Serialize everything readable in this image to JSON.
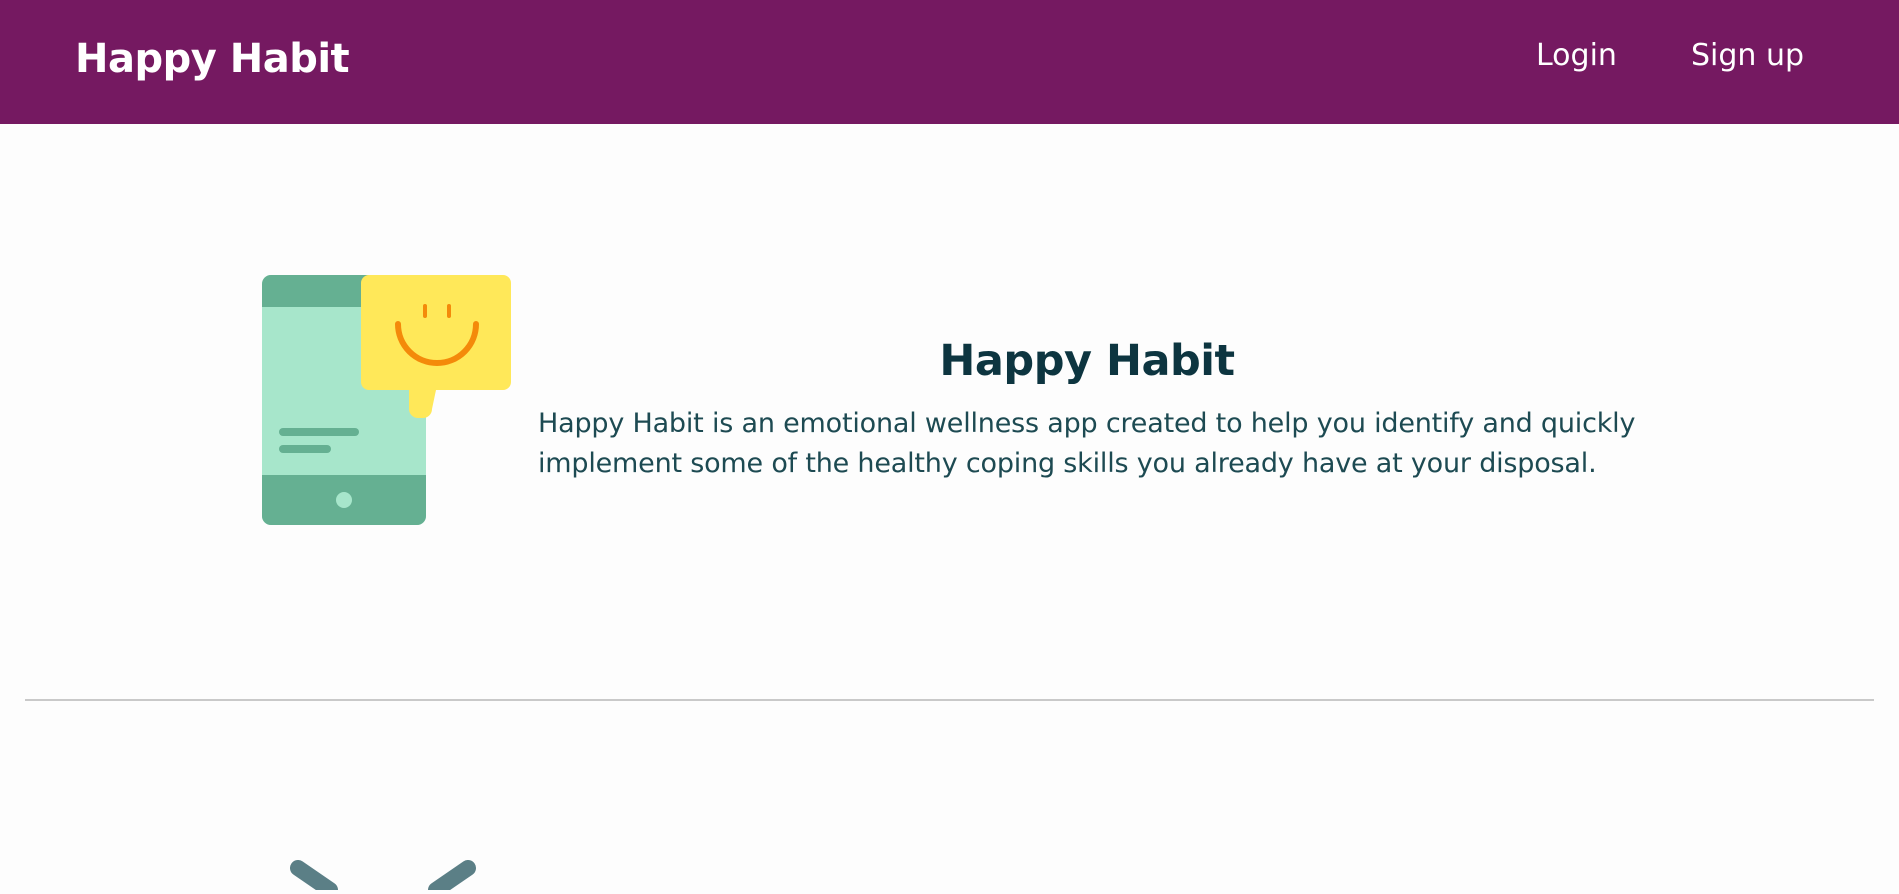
{
  "header": {
    "brand": "Happy Habit",
    "nav": {
      "login": "Login",
      "signup": "Sign up"
    }
  },
  "hero": {
    "illustration_icon": "phone-chat-smile-icon",
    "title": "Happy Habit",
    "description": "Happy Habit is an emotional wellness app created to help you identify and quickly implement some of the healthy coping skills you already have at your disposal."
  },
  "colors": {
    "header_bg": "#751961",
    "title_text": "#0d3540",
    "body_text": "#1d4a52",
    "phone_green_dark": "#65b092",
    "phone_green_light": "#a7e6cb",
    "bubble_yellow": "#ffe859",
    "smile_orange": "#f48a0a"
  },
  "next_section": {
    "icon": "chevron-partial-icon"
  }
}
